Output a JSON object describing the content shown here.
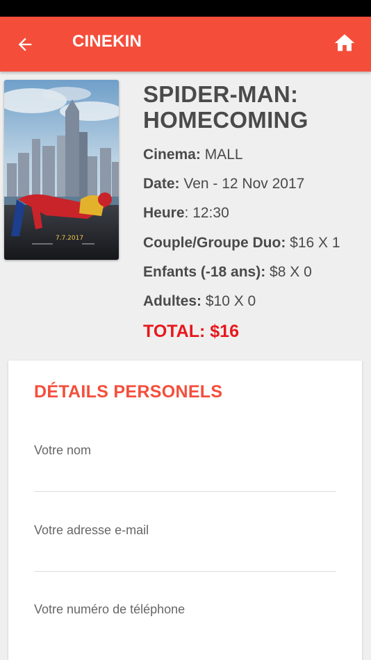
{
  "app_bar": {
    "title": "CINEKIN",
    "back_icon": "arrow-left-icon",
    "home_icon": "home-icon",
    "color": "#f44e3b"
  },
  "movie": {
    "title": "SPIDER-MAN: HOMECOMING",
    "poster_date": "7.7.2017",
    "details": [
      {
        "label": "Cinema:",
        "value": " MALL"
      },
      {
        "label": "Date:",
        "value": " Ven - 12 Nov 2017"
      },
      {
        "label": "Heure",
        "value": ": 12:30"
      },
      {
        "label": "Couple/Groupe Duo:",
        "value": " $16 X 1"
      },
      {
        "label": "Enfants (-18 ans):",
        "value": " $8 X 0"
      },
      {
        "label": "Adultes:",
        "value": " $10 X 0"
      }
    ],
    "total": "TOTAL: $16",
    "total_color": "#e8161b"
  },
  "personal_details": {
    "title": "DÉTAILS PERSONELS",
    "fields": [
      {
        "label": "Votre nom",
        "value": ""
      },
      {
        "label": "Votre adresse e-mail",
        "value": ""
      },
      {
        "label": "Votre numéro de téléphone",
        "value": ""
      }
    ]
  }
}
